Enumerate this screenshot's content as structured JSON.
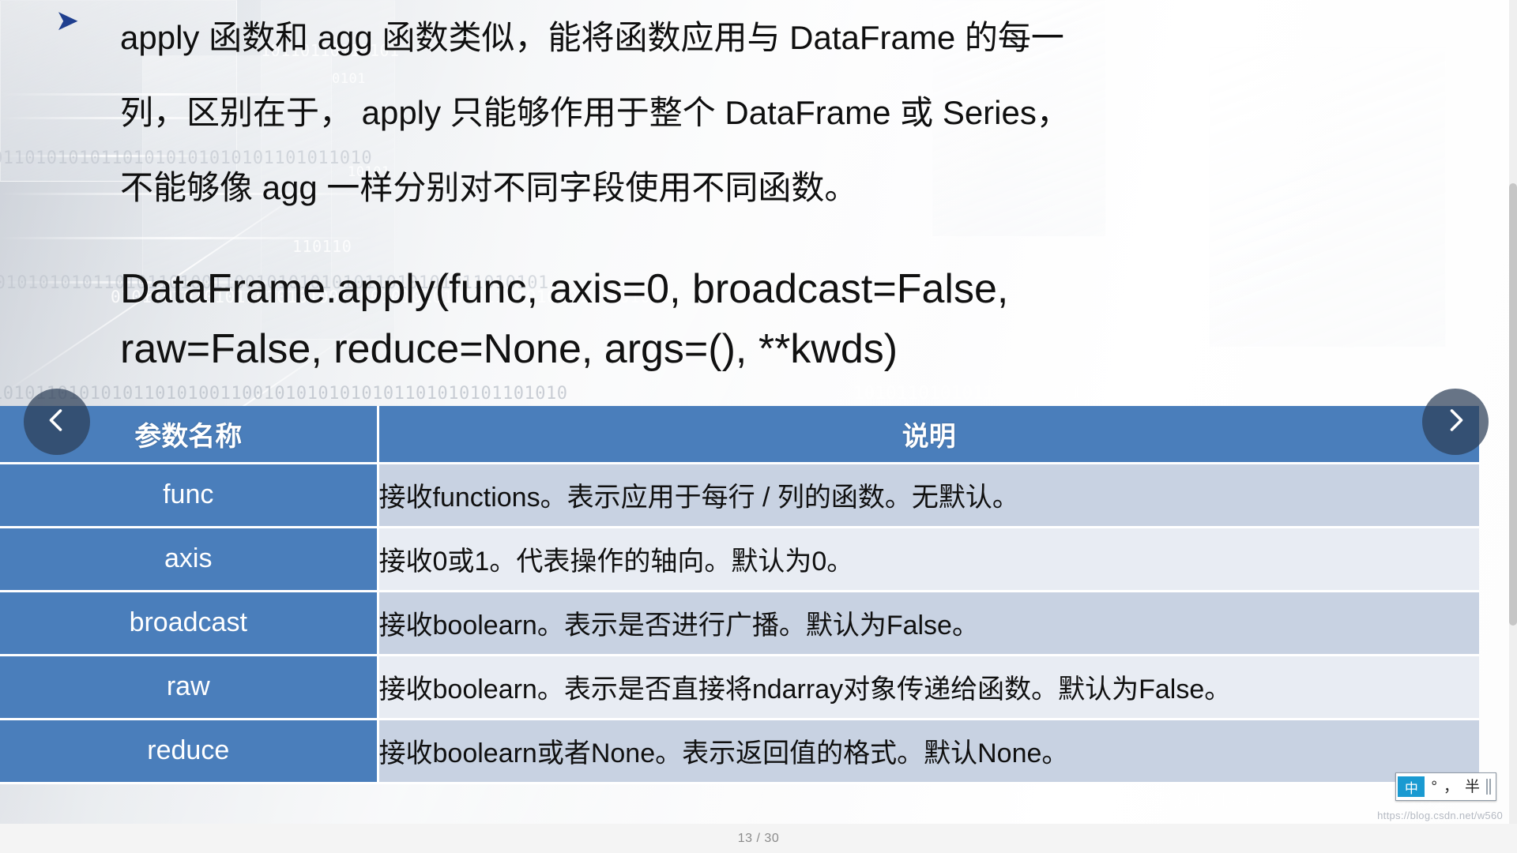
{
  "slide": {
    "bullet_marker": "➤",
    "paragraph_lines": [
      "apply 函数和 agg 函数类似，能将函数应用与 DataFrame 的每一",
      "列，区别在于， apply 只能够作用于整个 DataFrame 或 Series，",
      "不能够像 agg 一样分别对不同字段使用不同函数。"
    ],
    "signature_lines": [
      "DataFrame.apply(func, axis=0, broadcast=False,",
      "raw=False, reduce=None, args=(), **kwds)"
    ],
    "table": {
      "headers": [
        "参数名称",
        "说明"
      ],
      "rows": [
        {
          "name": "func",
          "desc": "接收functions。表示应用于每行 / 列的函数。无默认。"
        },
        {
          "name": "axis",
          "desc": "接收0或1。代表操作的轴向。默认为0。"
        },
        {
          "name": "broadcast",
          "desc": "接收boolearn。表示是否进行广播。默认为False。"
        },
        {
          "name": "raw",
          "desc": "接收boolearn。表示是否直接将ndarray对象传递给函数。默认为False。"
        },
        {
          "name": "reduce",
          "desc": "接收boolearn或者None。表示返回值的格式。默认None。"
        }
      ]
    },
    "background_binary": [
      "01101010101101010101010101101011010",
      "10110110110101",
      "110110",
      "0101",
      "10101",
      "1010101010110101101001100101010101011010101011010101",
      "0101101010101101010100110010101010101101010101101010101",
      "10101101010101101010011001010101010101101010101101010",
      "101011010101101010101",
      "1010110101101010101010101101010101"
    ]
  },
  "navigation": {
    "prev_label": "上一页",
    "next_label": "下一页",
    "page_indicator": "13 / 30",
    "current_page": "13",
    "total_pages": "30"
  },
  "ime": {
    "language_badge": "中",
    "mode_glyph": "°",
    "punctuation_glyph": "，",
    "shape_label": "半"
  },
  "watermark": {
    "text": "https://blog.csdn.net/w560"
  },
  "colors": {
    "table_header_blue": "#4a7ebb",
    "row_band_dark": "#c8d2e2",
    "row_band_light": "#e8ecf3",
    "bullet_blue": "#1f3f8f",
    "ime_badge": "#1a9ad1",
    "page_text": "#8a8a8a"
  }
}
